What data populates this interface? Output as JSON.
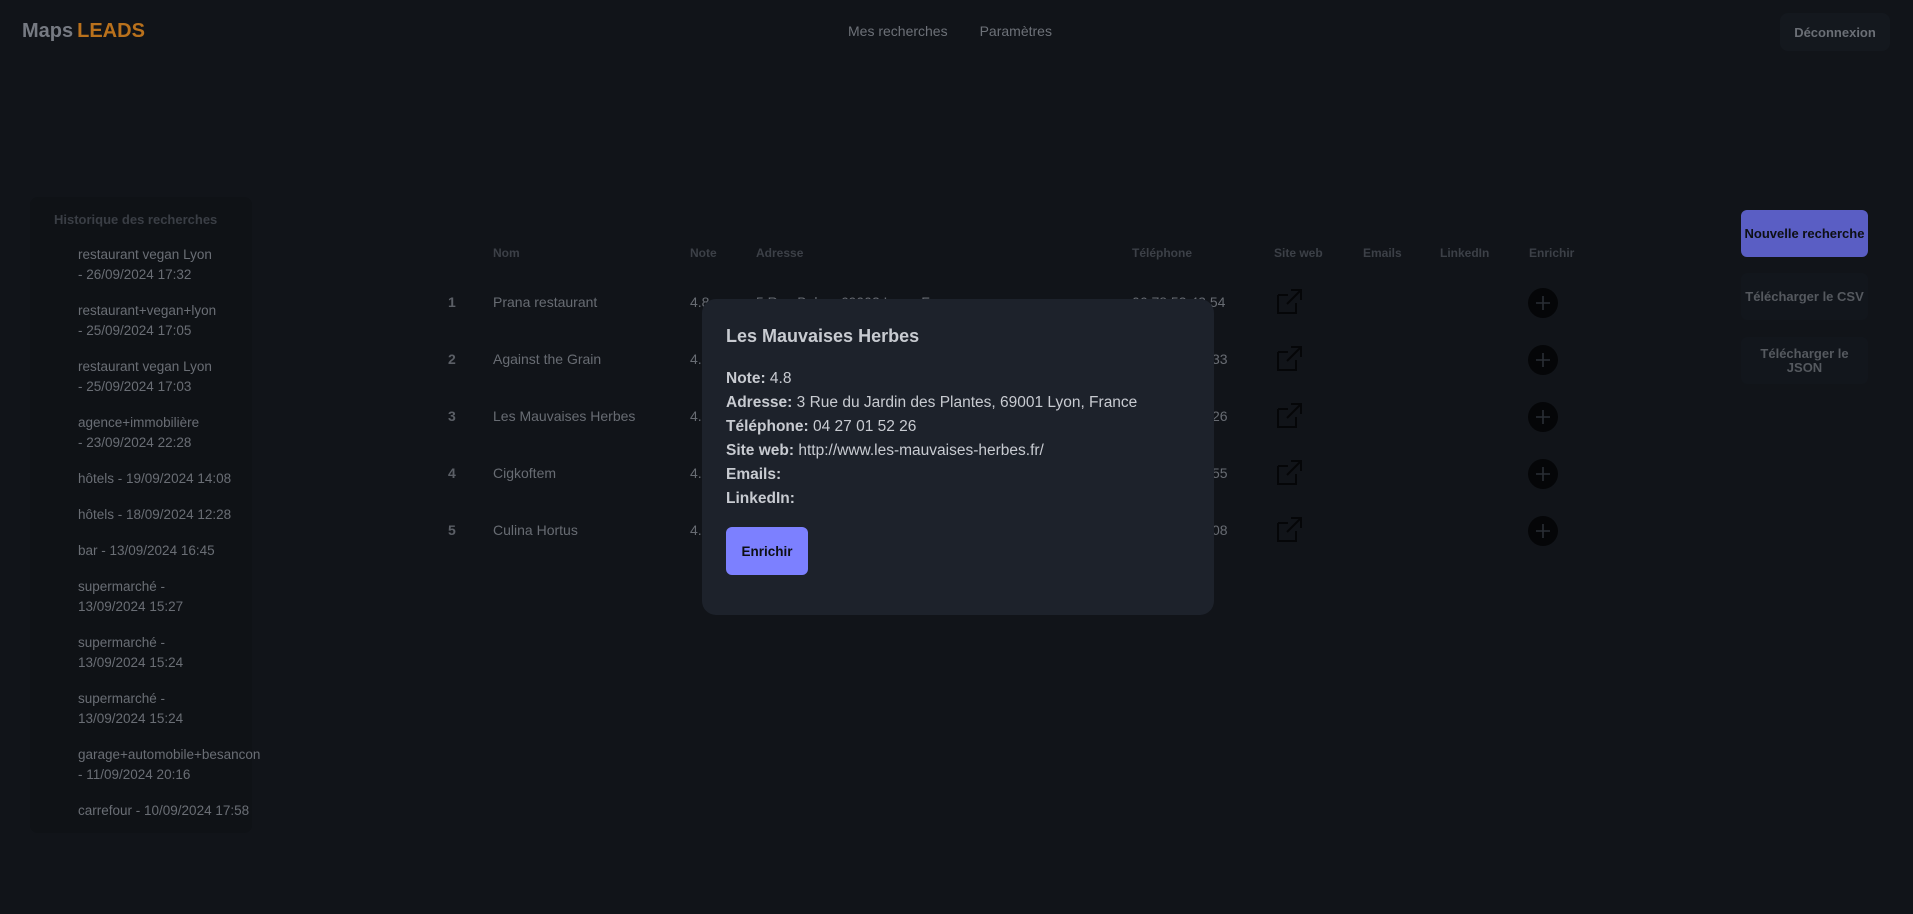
{
  "header": {
    "logo_part1": "Maps",
    "logo_part2": "LEADS",
    "nav": [
      "Mes recherches",
      "Paramètres"
    ],
    "logout_label": "Déconnexion"
  },
  "sidebar": {
    "title": "Historique des recherches",
    "items": [
      "restaurant vegan Lyon\n- 26/09/2024 17:32",
      "restaurant+vegan+lyon\n- 25/09/2024 17:05",
      "restaurant vegan Lyon\n- 25/09/2024 17:03",
      "agence+immobilière\n- 23/09/2024 22:28",
      "hôtels - 19/09/2024 14:08",
      "hôtels - 18/09/2024 12:28",
      "bar - 13/09/2024 16:45",
      "supermarché -\n13/09/2024 15:27",
      "supermarché -\n13/09/2024 15:24",
      "supermarché -\n13/09/2024 15:24",
      "garage+automobile+besancon\n- 11/09/2024 20:16",
      "carrefour - 10/09/2024 17:58"
    ]
  },
  "table": {
    "headers": [
      "Nom",
      "Note",
      "Adresse",
      "Téléphone",
      "Site web",
      "Emails",
      "LinkedIn",
      "Enrichir"
    ],
    "rows": [
      {
        "num": "1",
        "name": "Prana restaurant",
        "note": "4.8",
        "address": "5 Rue Bele... 69002 Lyon, F...",
        "phone": "06 78 53 43 54"
      },
      {
        "num": "2",
        "name": "Against the Grain",
        "note": "4.",
        "address": "",
        "phone": "33"
      },
      {
        "num": "3",
        "name": "Les Mauvaises Herbes",
        "note": "4.",
        "address": "",
        "phone": "26"
      },
      {
        "num": "4",
        "name": "Cigkoftem",
        "note": "4.",
        "address": "",
        "phone": "55"
      },
      {
        "num": "5",
        "name": "Culina Hortus",
        "note": "4.",
        "address": "",
        "phone": "08"
      }
    ]
  },
  "actions": {
    "new_search": "Nouvelle recherche",
    "download_csv": "Télécharger le CSV",
    "download_json": "Télécharger le JSON"
  },
  "modal": {
    "title": "Les Mauvaises Herbes",
    "note_label": "Note:",
    "note_value": "4.8",
    "address_label": "Adresse:",
    "address_value": "3 Rue du Jardin des Plantes, 69001 Lyon, France",
    "phone_label": "Téléphone:",
    "phone_value": "04 27 01 52 26",
    "website_label": "Site web:",
    "website_value": "http://www.les-mauvaises-herbes.fr/",
    "emails_label": "Emails:",
    "linkedin_label": "LinkedIn:",
    "enrich_label": "Enrichir"
  },
  "icons": {
    "external_link": "external-link-icon",
    "plus": "plus-circle-icon"
  },
  "colors": {
    "background": "#111419",
    "accent": "#7c80ff",
    "accent_dim": "#5a5ec4",
    "brand": "#b9711c",
    "modal_bg": "#1d222b"
  }
}
